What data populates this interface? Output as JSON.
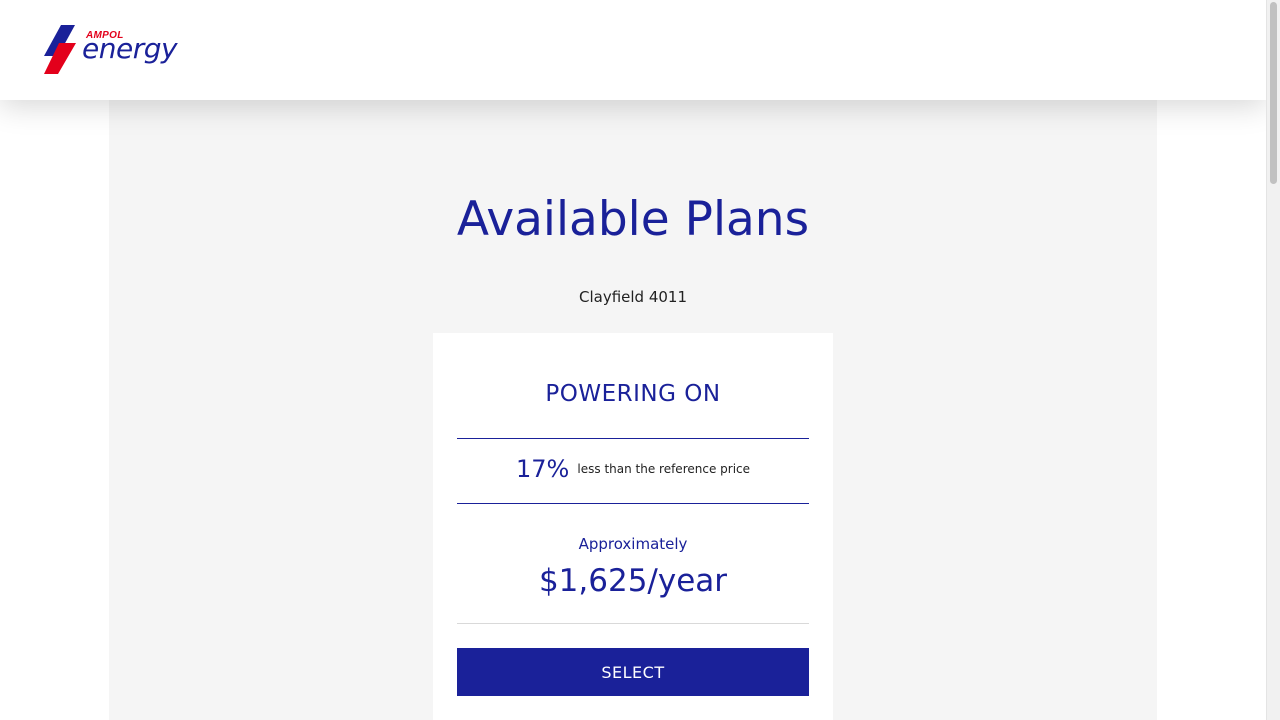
{
  "header": {
    "logo": {
      "brand": "AMPOL",
      "product": "energy",
      "icon": "ampol-bolt-logo-icon",
      "colors": {
        "red": "#e3001b",
        "blue": "#1a2199"
      }
    }
  },
  "main": {
    "title": "Available Plans",
    "location": "Clayfield 4011"
  },
  "plan": {
    "name": "POWERING ON",
    "discount_percent": "17%",
    "discount_text": "less than the reference price",
    "approx_label": "Approximately",
    "price": "$1,625/year",
    "select_label": "SELECT"
  },
  "colors": {
    "accent": "#1a2199",
    "brand_red": "#e3001b",
    "content_bg": "#f5f5f5",
    "card_bg": "#ffffff"
  }
}
